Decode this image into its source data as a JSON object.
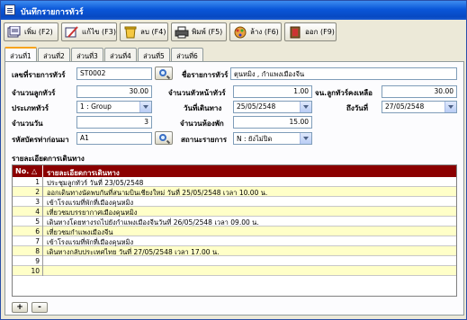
{
  "window": {
    "title": "บันทึกรายการทัวร์"
  },
  "toolbar": [
    {
      "label": "เพิ่ม (F2)",
      "icon": "add-icon"
    },
    {
      "label": "แก้ไข (F3)",
      "icon": "edit-icon"
    },
    {
      "label": "ลบ (F4)",
      "icon": "delete-icon"
    },
    {
      "label": "พิมพ์ (F5)",
      "icon": "print-icon"
    },
    {
      "label": "ล้าง (F6)",
      "icon": "clear-icon"
    },
    {
      "label": "ออก (F9)",
      "icon": "exit-icon"
    }
  ],
  "tabs": [
    "ส่วนที่1",
    "ส่วนที่2",
    "ส่วนที่3",
    "ส่วนที่4",
    "ส่วนที่5",
    "ส่วนที่6"
  ],
  "form": {
    "tour_code": {
      "label": "เลขที่รายการทัวร์",
      "value": "ST0002"
    },
    "tour_name": {
      "label": "ชื่อรายการทัวร์",
      "value": "ตุนหมิง , กำแพงเมืองจีน"
    },
    "guests": {
      "label": "จำนวนลูกทัวร์",
      "value": "30.00"
    },
    "leaders": {
      "label": "จำนวนหัวหน้าทัวร์",
      "value": "1.00"
    },
    "remaining": {
      "label": "จน.ลูกทัวร์คงเหลือ",
      "value": "30.00"
    },
    "tour_type": {
      "label": "ประเภททัวร์",
      "value": "1 : Group"
    },
    "start_date": {
      "label": "วันที่เดินทาง",
      "value": "25/05/2548"
    },
    "end_date": {
      "label": "ถึงวันที่",
      "value": "27/05/2548"
    },
    "days": {
      "label": "จำนวนวัน",
      "value": "3"
    },
    "rooms": {
      "label": "จำนวนห้องพัก",
      "value": "15.00"
    },
    "agency_code": {
      "label": "รหัสบัตรท่าก่อนมา",
      "value": "A1"
    },
    "status": {
      "label": "สถานะรายการ",
      "value": "N : ยังไม่ปิด"
    }
  },
  "grid": {
    "title": "รายละเอียดการเดินทาง",
    "headers": [
      "No. △",
      "รายละเอียดการเดินทาง"
    ],
    "rows": [
      {
        "no": "1",
        "text": "ประชุมลูกทัวร์ วันที่ 23/05/2548"
      },
      {
        "no": "2",
        "text": "ออกเดินทางนัดพบกันที่สนามบินเชียงใหม่ วันที่ 25/05/2548 เวลา 10.00 น."
      },
      {
        "no": "3",
        "text": "เข้าโรงแรมที่พักที่เมืองคุนหมิง"
      },
      {
        "no": "4",
        "text": "เที่ยวชมบรรยากาศเมืองคุนหมิง"
      },
      {
        "no": "5",
        "text": "เดินทางโดยทางรถไปยังกำแพงเมืองจีนวันที่ 26/05/2548 เวลา 09.00 น."
      },
      {
        "no": "6",
        "text": "เที่ยวชมกำแพงเมืองจีน"
      },
      {
        "no": "7",
        "text": "เข้าโรงแรมที่พักที่เมืองคุนหมิง"
      },
      {
        "no": "8",
        "text": "เดินทางกลับประเทศไทย วันที่ 27/05/2548 เวลา 17.00 น."
      },
      {
        "no": "9",
        "text": ""
      },
      {
        "no": "10",
        "text": ""
      }
    ]
  },
  "row_buttons": {
    "add": "+",
    "remove": "-"
  },
  "colors": {
    "header_bg": "#8b0000",
    "alt_row": "#ffffc8",
    "title_bar": "#0a56d8"
  }
}
